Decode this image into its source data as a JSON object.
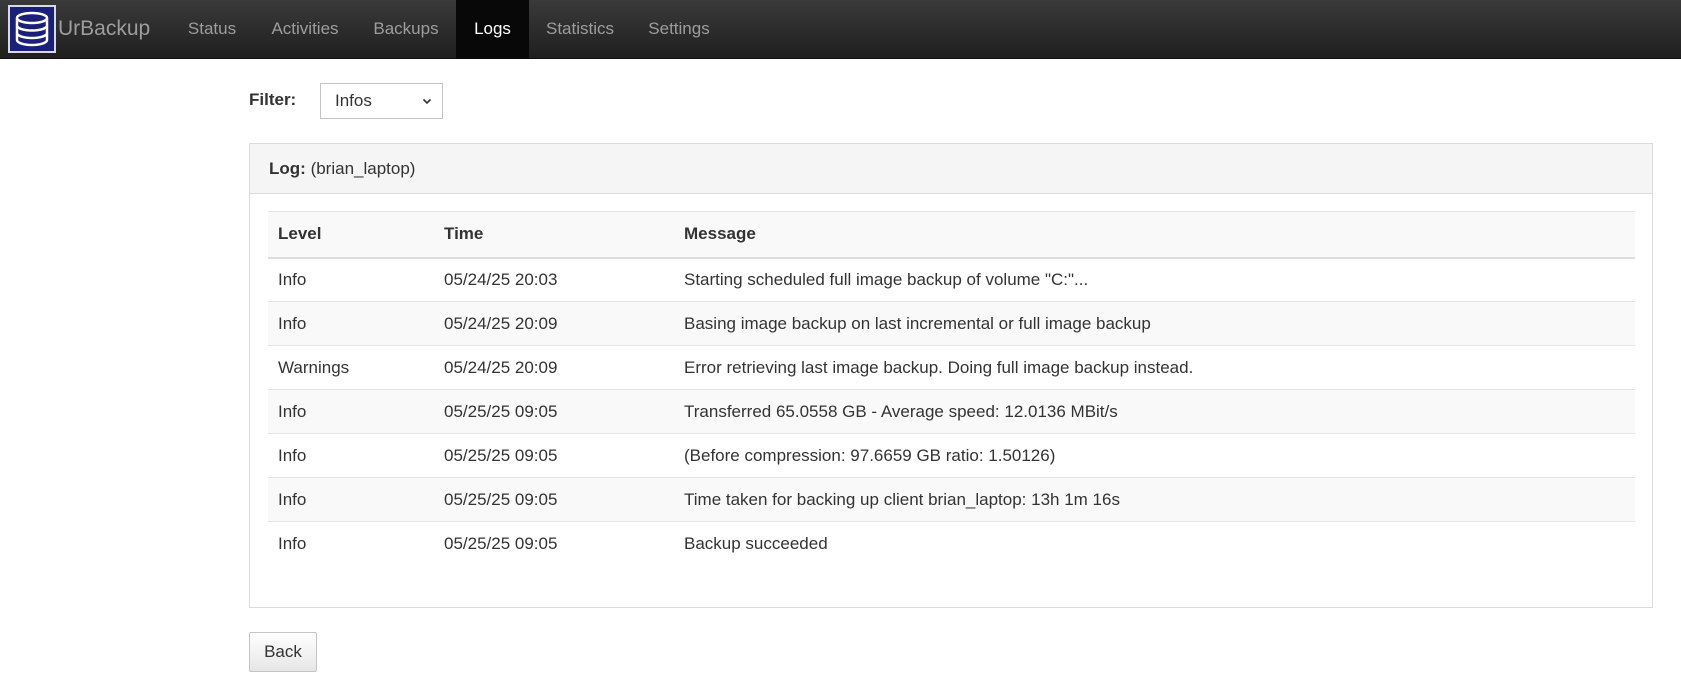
{
  "app": {
    "brand_text": "UrBackup",
    "logo_icon": "database-icon"
  },
  "nav": {
    "items": [
      {
        "label": "Status"
      },
      {
        "label": "Activities"
      },
      {
        "label": "Backups"
      },
      {
        "label": "Logs",
        "active": true
      },
      {
        "label": "Statistics"
      },
      {
        "label": "Settings"
      }
    ]
  },
  "filter": {
    "label": "Filter:",
    "selected": "Infos"
  },
  "panel": {
    "heading_label": "Log:",
    "heading_value": "(brian_laptop)"
  },
  "table": {
    "headers": {
      "level": "Level",
      "time": "Time",
      "message": "Message"
    },
    "rows": [
      {
        "level": "Info",
        "time": "05/24/25 20:03",
        "message": "Starting scheduled full image backup of volume \"C:\"..."
      },
      {
        "level": "Info",
        "time": "05/24/25 20:09",
        "message": "Basing image backup on last incremental or full image backup"
      },
      {
        "level": "Warnings",
        "time": "05/24/25 20:09",
        "message": "Error retrieving last image backup. Doing full image backup instead."
      },
      {
        "level": "Info",
        "time": "05/25/25 09:05",
        "message": "Transferred 65.0558 GB - Average speed: 12.0136 MBit/s"
      },
      {
        "level": "Info",
        "time": "05/25/25 09:05",
        "message": "(Before compression: 97.6659 GB ratio: 1.50126)"
      },
      {
        "level": "Info",
        "time": "05/25/25 09:05",
        "message": "Time taken for backing up client brian_laptop: 13h 1m 16s"
      },
      {
        "level": "Info",
        "time": "05/25/25 09:05",
        "message": "Backup succeeded"
      }
    ]
  },
  "back_button": {
    "label": "Back"
  }
}
